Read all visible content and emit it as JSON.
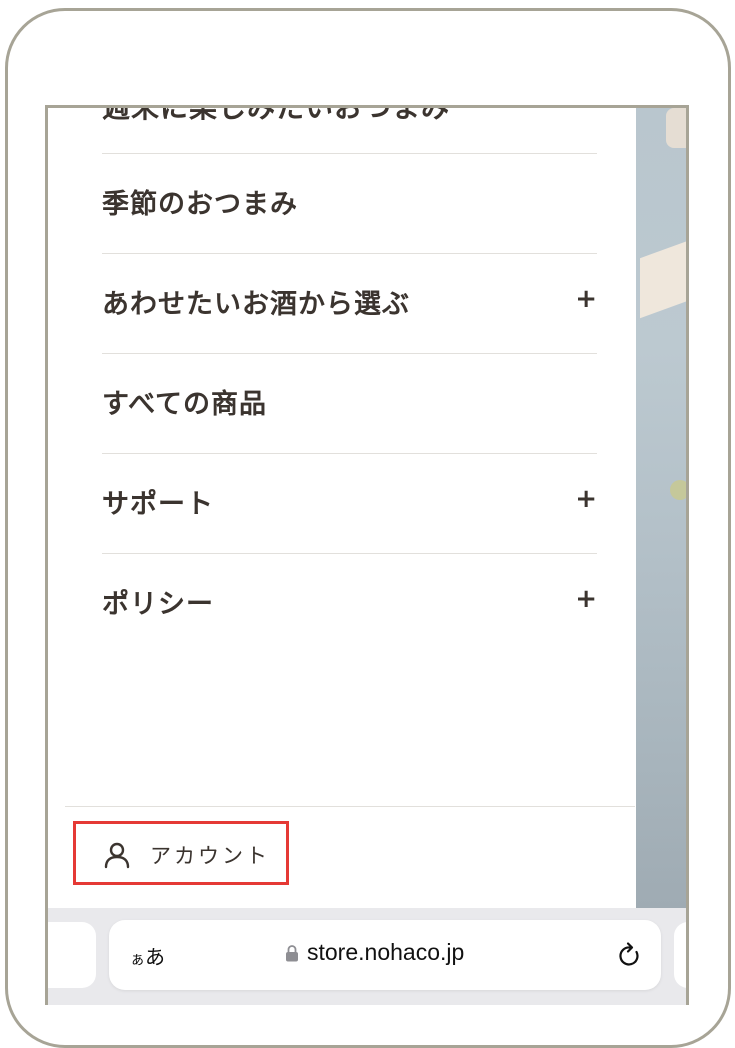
{
  "menu": {
    "partial_item_label": "週末に楽しみたいおつまみ",
    "items": [
      {
        "label": "季節のおつまみ",
        "expand": ""
      },
      {
        "label": "あわせたいお酒から選ぶ",
        "expand": "+"
      },
      {
        "label": "すべての商品",
        "expand": ""
      },
      {
        "label": "サポート",
        "expand": "+"
      },
      {
        "label": "ポリシー",
        "expand": "+"
      }
    ]
  },
  "footer": {
    "account_label": "アカウント",
    "account_icon": "person-icon",
    "highlight_color": "#e53935"
  },
  "browser": {
    "aa_small": "ぁ",
    "aa_large": "あ",
    "url": "store.nohaco.jp",
    "lock_icon": "lock-icon",
    "reload_icon": "reload-icon"
  },
  "colors": {
    "text": "#3b342f",
    "divider": "#e2e0dc",
    "frame": "#a7a496",
    "browser_bar": "#e9e9ec"
  }
}
